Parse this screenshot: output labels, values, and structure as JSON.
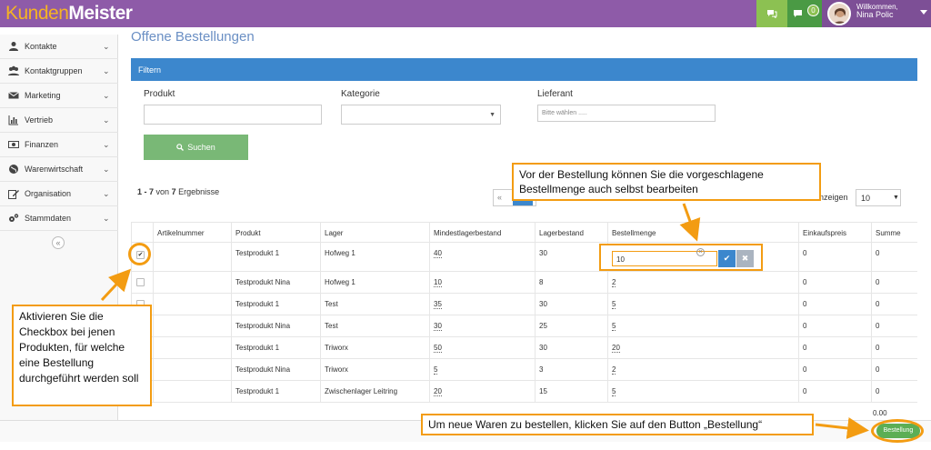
{
  "brand": {
    "part1": "Kunden",
    "part2": "Meister"
  },
  "topbar": {
    "chat_badge": "0",
    "welcome": "Willkommen,",
    "user_name": "Nina Polic"
  },
  "sidebar": {
    "items": [
      {
        "label": "Kontakte",
        "icon": "person-icon"
      },
      {
        "label": "Kontaktgruppen",
        "icon": "group-icon"
      },
      {
        "label": "Marketing",
        "icon": "envelope-icon"
      },
      {
        "label": "Vertrieb",
        "icon": "bar-chart-icon"
      },
      {
        "label": "Finanzen",
        "icon": "money-icon"
      },
      {
        "label": "Warenwirtschaft",
        "icon": "globe-icon"
      },
      {
        "label": "Organisation",
        "icon": "edit-icon"
      },
      {
        "label": "Stammdaten",
        "icon": "gears-icon"
      }
    ],
    "collapse_glyph": "«"
  },
  "page": {
    "title": "Offene Bestellungen"
  },
  "filter": {
    "header": "Filtern",
    "produkt_label": "Produkt",
    "produkt_value": "",
    "kategorie_label": "Kategorie",
    "kategorie_value": "",
    "lieferant_label": "Lieferant",
    "lieferant_placeholder": "Bitte wählen .....",
    "search_label": "Suchen"
  },
  "results": {
    "range": "1 - 7",
    "of": "von",
    "total": "7",
    "suffix": "Ergebnisse",
    "pager_prev": "«"
  },
  "per_page": {
    "label": "anzeigen",
    "value": "10"
  },
  "table": {
    "headers": [
      "",
      "Artikelnummer",
      "Produkt",
      "Lager",
      "Mindestlagerbestand",
      "Lagerbestand",
      "Bestellmenge",
      "Einkaufspreis",
      "Summe"
    ],
    "rows": [
      {
        "checked": true,
        "artikel": "",
        "produkt": "Testprodukt 1",
        "lager": "Hofweg 1",
        "min": "40",
        "bestand": "30",
        "menge": "10",
        "preis": "0",
        "summe": "0"
      },
      {
        "checked": false,
        "artikel": "",
        "produkt": "Testprodukt Nina",
        "lager": "Hofweg 1",
        "min": "10",
        "bestand": "8",
        "menge": "2",
        "preis": "0",
        "summe": "0"
      },
      {
        "checked": false,
        "artikel": "",
        "produkt": "Testprodukt 1",
        "lager": "Test",
        "min": "35",
        "bestand": "30",
        "menge": "5",
        "preis": "0",
        "summe": "0"
      },
      {
        "checked": false,
        "artikel": "",
        "produkt": "Testprodukt Nina",
        "lager": "Test",
        "min": "30",
        "bestand": "25",
        "menge": "5",
        "preis": "0",
        "summe": "0"
      },
      {
        "checked": false,
        "artikel": "",
        "produkt": "Testprodukt 1",
        "lager": "Triworx",
        "min": "50",
        "bestand": "30",
        "menge": "20",
        "preis": "0",
        "summe": "0"
      },
      {
        "checked": false,
        "artikel": "",
        "produkt": "Testprodukt Nina",
        "lager": "Triworx",
        "min": "5",
        "bestand": "3",
        "menge": "2",
        "preis": "0",
        "summe": "0"
      },
      {
        "checked": false,
        "artikel": "",
        "produkt": "Testprodukt 1",
        "lager": "Zwischenlager Leitring",
        "min": "20",
        "bestand": "15",
        "menge": "5",
        "preis": "0",
        "summe": "0"
      }
    ],
    "total": "0.00"
  },
  "footer": {
    "order_button": "Bestellung"
  },
  "callouts": {
    "edit": "Vor der Bestellung können Sie die vorgeschlagene Bestellmenge auch selbst bearbeiten",
    "checkbox": "Aktivieren Sie die Checkbox bei jenen Produkten, für welche eine Bestellung durchgeführt werden soll",
    "button": "Um neue Waren zu bestellen, klicken Sie auf den Button „Bestellung“"
  },
  "colors": {
    "topbar": "#8e5ba8",
    "accent": "#3c87cd",
    "success": "#79b876",
    "callout": "#f39c12"
  }
}
